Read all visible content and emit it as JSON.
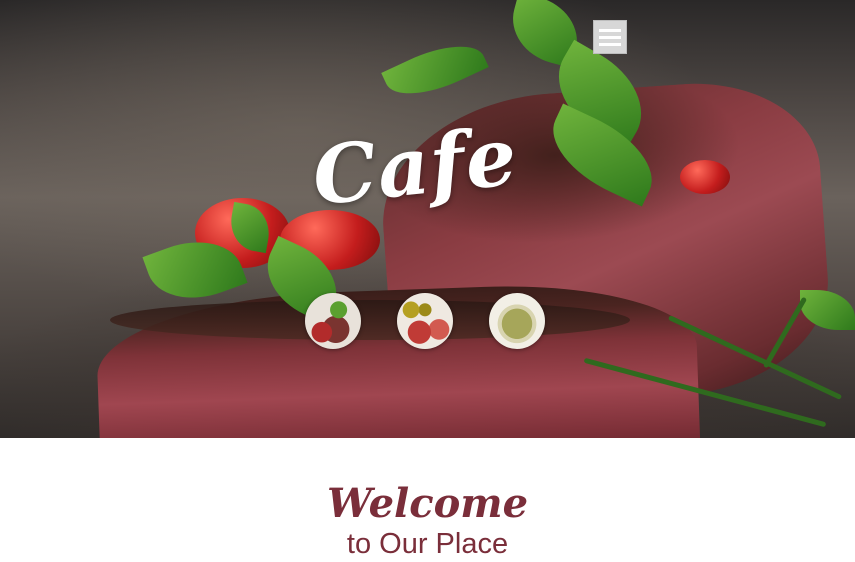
{
  "hero": {
    "title": "Cafe",
    "menu_icon": "hamburger-menu-icon",
    "thumbnails": [
      {
        "name": "steak-dish"
      },
      {
        "name": "olives-and-ham"
      },
      {
        "name": "herb-salad"
      }
    ]
  },
  "welcome": {
    "title": "Welcome",
    "subtitle": "to Our Place"
  },
  "colors": {
    "accent": "#7a2e3a",
    "menu_button_bg": "#d7d7d7",
    "hero_title": "#ffffff"
  }
}
